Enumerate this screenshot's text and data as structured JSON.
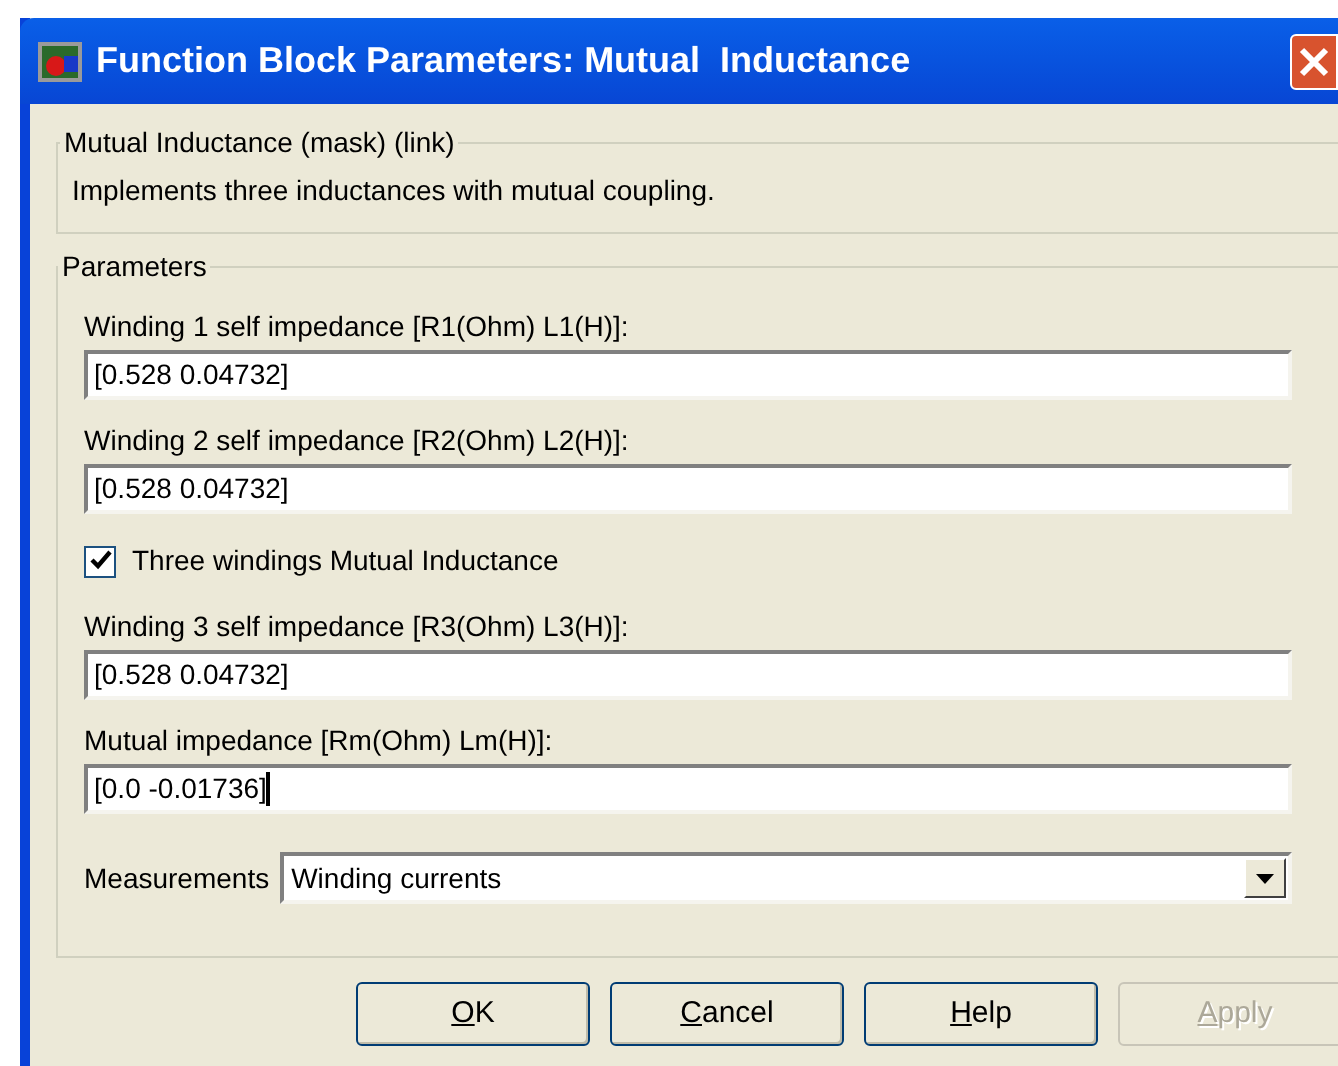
{
  "window": {
    "title": "Function Block Parameters: Mutual  Inductance"
  },
  "description_group": {
    "title": "Mutual Inductance (mask) (link)",
    "text": "Implements three inductances with mutual coupling."
  },
  "parameters_group": {
    "title": "Parameters",
    "items": [
      {
        "kind": "text",
        "label": "Winding 1 self impedance [R1(Ohm) L1(H)]:",
        "value": "[0.528 0.04732]"
      },
      {
        "kind": "text",
        "label": "Winding 2 self impedance [R2(Ohm) L2(H)]:",
        "value": "[0.528 0.04732]"
      },
      {
        "kind": "checkbox",
        "label": "Three windings Mutual Inductance",
        "checked": true
      },
      {
        "kind": "text",
        "label": "Winding 3 self impedance [R3(Ohm) L3(H)]:",
        "value": "[0.528 0.04732]"
      },
      {
        "kind": "text",
        "label": "Mutual impedance [Rm(Ohm) Lm(H)]:",
        "value": "[0.0 -0.01736]",
        "focused": true
      },
      {
        "kind": "dropdown",
        "label": "Measurements",
        "value": "Winding currents"
      }
    ]
  },
  "buttons": [
    {
      "label": "OK",
      "disabled": false
    },
    {
      "label": "Cancel",
      "disabled": false
    },
    {
      "label": "Help",
      "disabled": false
    },
    {
      "label": "Apply",
      "disabled": true
    }
  ]
}
